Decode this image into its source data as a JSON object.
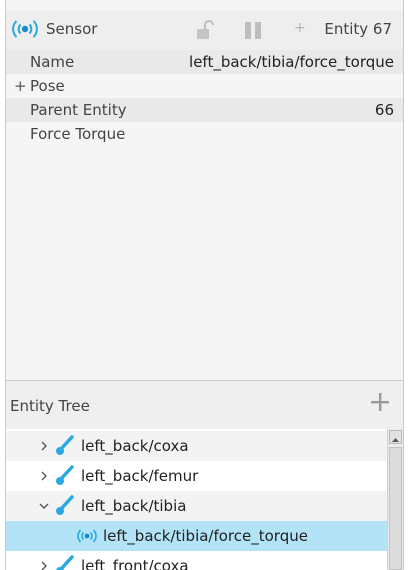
{
  "component": {
    "title": "Sensor",
    "icon": "sensor-icon",
    "entity_label": "Entity 67",
    "lock_icon": "unlocked-padlock-icon",
    "pause_icon": "pause-icon",
    "add_icon": "plus-icon"
  },
  "properties": [
    {
      "label": "Name",
      "value": "left_back/tibia/force_torque"
    },
    {
      "label": "Pose",
      "expand_symbol": "+"
    },
    {
      "label": "Parent Entity",
      "value": "66"
    },
    {
      "label": "Force Torque"
    }
  ],
  "entity_tree": {
    "title": "Entity Tree",
    "add_icon": "plus-icon",
    "items": [
      {
        "label": "left_back/coxa",
        "icon": "link-icon",
        "state": "collapsed"
      },
      {
        "label": "left_back/femur",
        "icon": "link-icon",
        "state": "collapsed"
      },
      {
        "label": "left_back/tibia",
        "icon": "link-icon",
        "state": "expanded"
      },
      {
        "label": "left_back/tibia/force_torque",
        "icon": "sensor-icon",
        "state": "selected"
      },
      {
        "label": "left_front/coxa",
        "icon": "link-icon",
        "state": "collapsed"
      }
    ]
  },
  "colors": {
    "accent": "#29a9df",
    "selected_row": "#b3e3f7"
  }
}
